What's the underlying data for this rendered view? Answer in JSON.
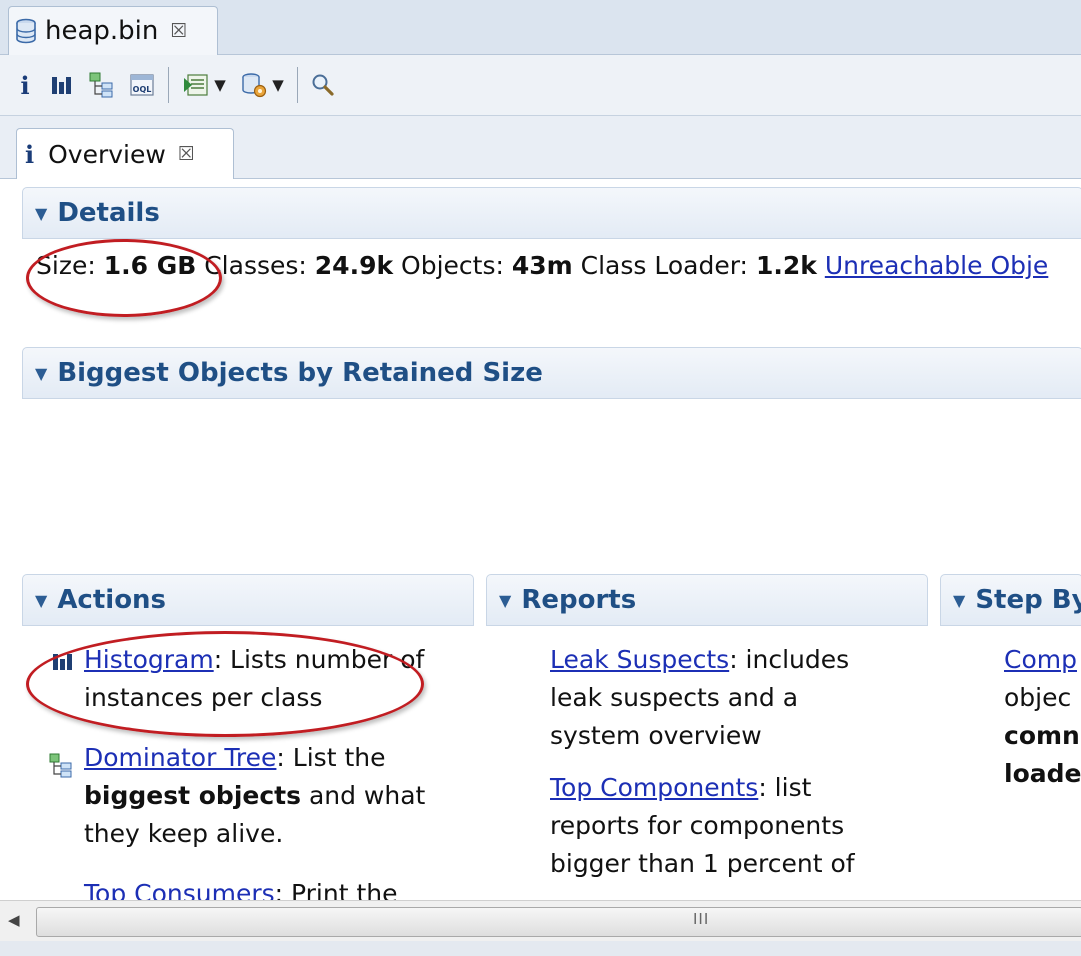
{
  "editor": {
    "tab_label": "heap.bin",
    "close_glyph": "☒"
  },
  "toolbar": {
    "items": [
      "info-icon",
      "histogram-icon",
      "dominator-tree-icon",
      "oql-icon",
      "run-report-icon",
      "query-browser-icon",
      "search-icon"
    ]
  },
  "overview_tab": {
    "info_glyph": "i",
    "label": "Overview",
    "close_glyph": "☒"
  },
  "details": {
    "title": "Details",
    "size_label": "Size: ",
    "size_value": "1.6 GB",
    "classes_label": " Classes: ",
    "classes_value": "24.9k",
    "objects_label": " Objects: ",
    "objects_value": "43m",
    "loader_label": " Class Loader: ",
    "loader_value": "1.2k",
    "unreachable_link": "Unreachable Obje"
  },
  "biggest": {
    "title": "Biggest Objects by Retained Size"
  },
  "actions": {
    "title": "Actions",
    "histogram_link": "Histogram",
    "histogram_desc": ": Lists number of instances per class",
    "dominator_link": "Dominator Tree",
    "dominator_desc1": ": List the ",
    "dominator_bold": "biggest objects",
    "dominator_desc2": " and what they keep alive.",
    "consumers_link": "Top Consumers",
    "consumers_desc": ": Print the"
  },
  "reports": {
    "title": "Reports",
    "leak_link": "Leak Suspects",
    "leak_desc": ": includes leak suspects and a system overview",
    "topcomp_link": "Top Components",
    "topcomp_desc": ": list reports for components bigger than 1 percent of"
  },
  "stepby": {
    "title": "Step By",
    "line1": "Comp",
    "line2": "objec",
    "line3": "comn",
    "line4": "loade"
  },
  "colors": {
    "accent": "#1f4f85",
    "link": "#1c2fb5",
    "highlight": "#c11d22"
  }
}
